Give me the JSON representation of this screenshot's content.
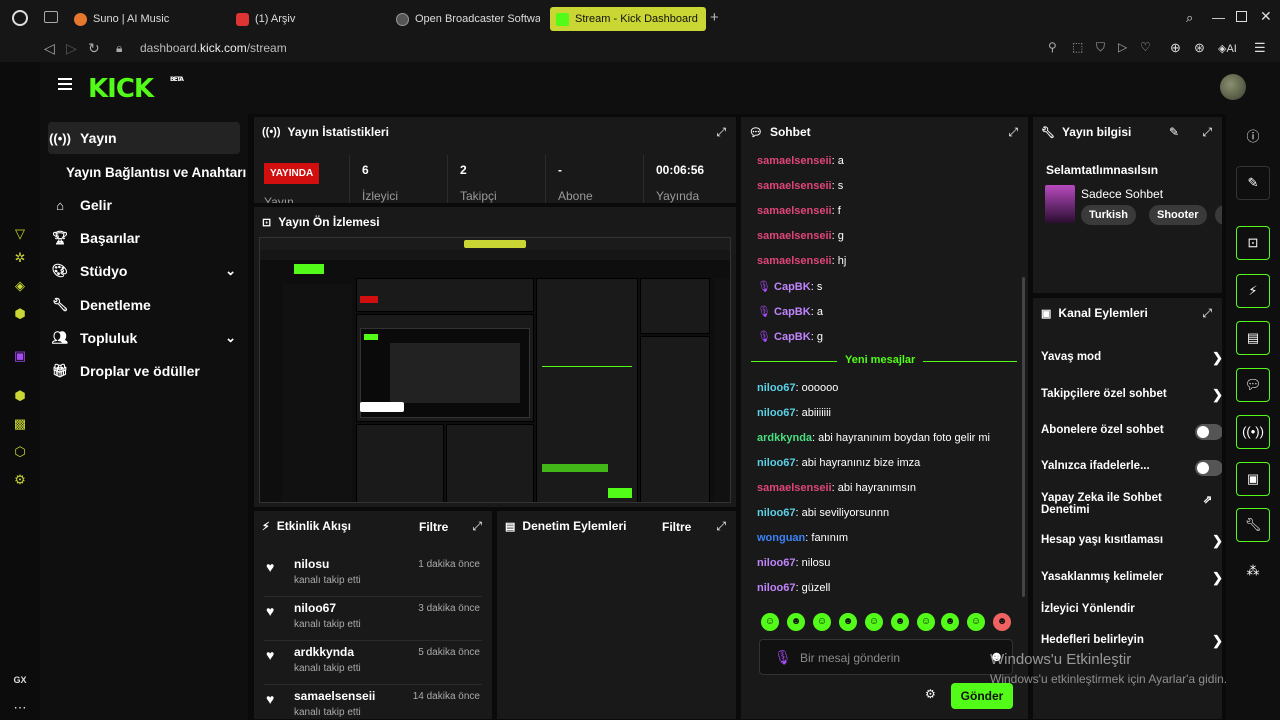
{
  "browser": {
    "tabs": [
      {
        "label": "Suno | AI Music",
        "color": "#e8772e"
      },
      {
        "label": "(1) Arşiv",
        "color": "#e03333"
      },
      {
        "label": "Open Broadcaster Software",
        "color": "#888888"
      },
      {
        "label": "Stream - Kick Dashboard",
        "color": "#53fc18"
      }
    ],
    "url_prefix": "dashboard.",
    "url_domain": "kick.com",
    "url_path": "/stream",
    "ai_label": "AI",
    "gx_label": "GX"
  },
  "kick": {
    "logo": "KICK",
    "logo_badge": "BETA",
    "accent": "#53fc18"
  },
  "nav": {
    "items": [
      {
        "label": "Yayın",
        "icon": "broadcast-icon"
      },
      {
        "label": "Yayın Bağlantısı ve Anahtarı"
      },
      {
        "label": "Gelir",
        "icon": "bank-icon"
      },
      {
        "label": "Başarılar",
        "icon": "trophy-icon"
      },
      {
        "label": "Stüdyo",
        "icon": "palette-icon"
      },
      {
        "label": "Denetleme",
        "icon": "wrench-icon"
      },
      {
        "label": "Topluluk",
        "icon": "users-icon"
      },
      {
        "label": "Droplar ve ödüller",
        "icon": "gift-icon"
      }
    ]
  },
  "stats": {
    "title": "Yayın İstatistikleri",
    "live": "YAYINDA",
    "live_label": "Yayın",
    "items": [
      {
        "value": "6",
        "label": "İzleyici"
      },
      {
        "value": "2",
        "label": "Takipçi"
      },
      {
        "value": "-",
        "label": "Abone"
      },
      {
        "value": "00:06:56",
        "label": "Yayında"
      }
    ]
  },
  "preview": {
    "title": "Yayın Ön İzlemesi"
  },
  "activity": {
    "title": "Etkinlik Akışı",
    "filter": "Filtre",
    "items": [
      {
        "name": "nilosu",
        "sub": "kanalı takip etti",
        "time": "1 dakika önce"
      },
      {
        "name": "niloo67",
        "sub": "kanalı takip etti",
        "time": "3 dakika önce"
      },
      {
        "name": "ardkkynda",
        "sub": "kanalı takip etti",
        "time": "5 dakika önce"
      },
      {
        "name": "samaelsenseii",
        "sub": "kanalı takip etti",
        "time": "14 dakika önce"
      }
    ]
  },
  "moderation": {
    "title": "Denetim Eylemleri",
    "filter": "Filtre"
  },
  "chat": {
    "title": "Sohbet",
    "new_messages": "Yeni mesajlar",
    "messages_before": [
      {
        "user": "samaelsenseii",
        "text": ": a",
        "color": "#e0457b"
      },
      {
        "user": "samaelsenseii",
        "text": ": s",
        "color": "#e0457b"
      },
      {
        "user": "samaelsenseii",
        "text": ": f",
        "color": "#e0457b"
      },
      {
        "user": "samaelsenseii",
        "text": ": g",
        "color": "#e0457b"
      },
      {
        "user": "samaelsenseii",
        "text": ": hj",
        "color": "#e0457b"
      },
      {
        "user": "CapBK",
        "text": ": s",
        "color": "#c084fc"
      },
      {
        "user": "CapBK",
        "text": ": a",
        "color": "#c084fc"
      },
      {
        "user": "CapBK",
        "text": ": g",
        "color": "#c084fc"
      }
    ],
    "messages_after": [
      {
        "user": "niloo67",
        "text": ": oooooo",
        "color": "#5ad1e6"
      },
      {
        "user": "niloo67",
        "text": ": abiiiiiii",
        "color": "#5ad1e6"
      },
      {
        "user": "ardkkynda",
        "text": ": abi hayranınım boydan foto gelir mi",
        "color": "#4ade80"
      },
      {
        "user": "niloo67",
        "text": ": abi hayranınız bize imza",
        "color": "#5ad1e6"
      },
      {
        "user": "samaelsenseii",
        "text": ": abi hayranımsın",
        "color": "#e0457b"
      },
      {
        "user": "niloo67",
        "text": ": abi seviliyorsunnn",
        "color": "#5ad1e6"
      },
      {
        "user": "wonguan",
        "text": ": fanınım",
        "color": "#3b82f6"
      },
      {
        "user": "niloo67",
        "text": ": nilosu",
        "color": "#c084fc"
      },
      {
        "user": "niloo67",
        "text": ": güzell",
        "color": "#c084fc"
      }
    ],
    "placeholder": "Bir mesaj gönderin",
    "send": "Gönder"
  },
  "info": {
    "title": "Yayın bilgisi",
    "stream_title": "Selamtatlımnasılsın",
    "category": "Sadece Sohbet",
    "tags": [
      "Turkish",
      "Shooter"
    ]
  },
  "channel_actions": {
    "title": "Kanal Eylemleri",
    "items": [
      {
        "label": "Yavaş mod"
      },
      {
        "label": "Takipçilere özel sohbet"
      },
      {
        "label": "Abonelere özel sohbet"
      },
      {
        "label": "Yalnızca ifadelerle..."
      },
      {
        "label": "Yapay Zeka ile Sohbet Denetimi"
      },
      {
        "label": "Hesap yaşı kısıtlaması"
      },
      {
        "label": "Yasaklanmış kelimeler"
      },
      {
        "label": "İzleyici Yönlendir"
      },
      {
        "label": "Hedefleri belirleyin"
      }
    ]
  },
  "watermark": {
    "line1": "Windows'u Etkinleştir",
    "line2": "Windows'u etkinleştirmek için Ayarlar'a gidin."
  }
}
